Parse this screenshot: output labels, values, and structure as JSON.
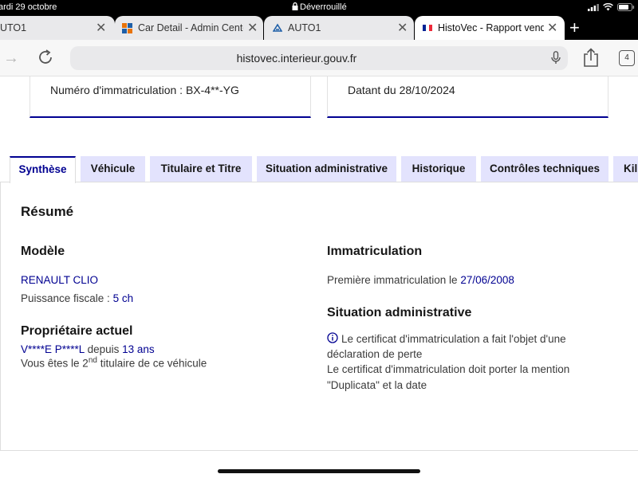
{
  "status_bar": {
    "date": "ardi 29 octobre",
    "lock_text": "Déverrouillé"
  },
  "browser_tabs": [
    {
      "title": "UTO1",
      "favicon": "none"
    },
    {
      "title": "Car Detail - Admin Cente",
      "favicon": "grid-logo-icon"
    },
    {
      "title": "AUTO1",
      "favicon": "auto1-logo-icon"
    },
    {
      "title": "HistoVec - Rapport vendeu",
      "favicon": "french-flag-icon",
      "active": true
    }
  ],
  "address_bar": {
    "url": "histovec.interieur.gouv.fr",
    "tab_count": "4"
  },
  "cards": {
    "registration": "Numéro d'immatriculation : BX-4**-YG",
    "date": "Datant du 28/10/2024"
  },
  "page_tabs": [
    {
      "label": "Synthèse",
      "active": true
    },
    {
      "label": "Véhicule"
    },
    {
      "label": "Titulaire et Titre"
    },
    {
      "label": "Situation administrative"
    },
    {
      "label": "Historique"
    },
    {
      "label": "Contrôles techniques"
    },
    {
      "label": "Kil"
    }
  ],
  "summary": {
    "heading": "Résumé",
    "model": {
      "heading": "Modèle",
      "name": "RENAULT CLIO",
      "power_label": "Puissance fiscale :",
      "power_value": "5 ch"
    },
    "owner": {
      "heading": "Propriétaire actuel",
      "name": "V****E P****L",
      "since_label": "depuis",
      "since_value": "13 ans",
      "rank_prefix": "Vous êtes le 2",
      "rank_sup": "nd",
      "rank_suffix": "titulaire de ce véhicule"
    },
    "registration": {
      "heading": "Immatriculation",
      "first_label": "Première immatriculation le",
      "first_date": "27/06/2008"
    },
    "admin_situation": {
      "heading": "Situation administrative",
      "line1": "Le certificat d'immatriculation a fait l'objet d'une",
      "line2": "déclaration de perte",
      "line3": "Le certificat d'immatriculation doit porter la mention",
      "line4": "\"Duplicata\" et la date"
    }
  },
  "colors": {
    "accent": "#000091",
    "tab_bg": "#e3e3fd",
    "text": "#161616"
  }
}
